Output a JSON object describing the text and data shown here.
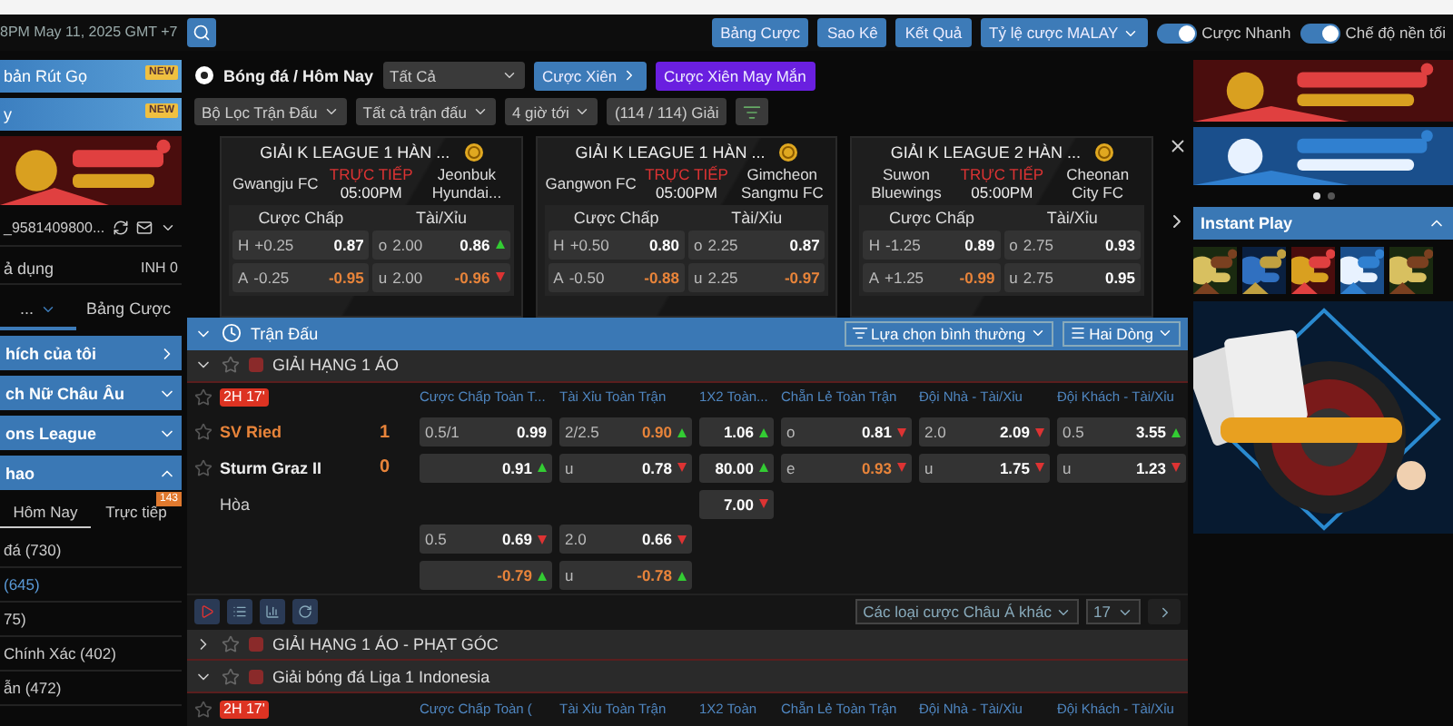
{
  "header": {
    "time": "8PM May 11, 2025 GMT +7",
    "buttons": [
      "Bảng Cược",
      "Sao Kê",
      "Kết Quả"
    ],
    "odds_type": "Tỷ lệ cược MALAY",
    "toggles": [
      {
        "label": "Cược Nhanh",
        "on": true
      },
      {
        "label": "Chế độ nền tối",
        "on": true
      }
    ]
  },
  "sidebar": {
    "promos": [
      {
        "label": "bản Rút Gọ",
        "badge": "NEW"
      },
      {
        "label": "y",
        "badge": "NEW"
      }
    ],
    "account": "_9581409800...",
    "balance_label": "ả dụng",
    "balance": "INH 0",
    "tabs": [
      {
        "label": "...",
        "selected": true
      },
      {
        "label": "Bảng Cược",
        "selected": false
      }
    ],
    "sections": [
      {
        "label": "hích của tôi",
        "kind": "link"
      },
      {
        "label": "ch Nữ Châu Âu",
        "kind": "group",
        "expanded": false
      },
      {
        "label": "ons League",
        "kind": "group",
        "expanded": false
      },
      {
        "label": "hao",
        "kind": "group",
        "expanded": true
      }
    ],
    "sport_tabs": [
      {
        "label": "Hôm Nay",
        "selected": true
      },
      {
        "label": "Trực tiếp",
        "selected": false,
        "badge": "143"
      }
    ],
    "sports": [
      {
        "label": "đá (730)",
        "selected": false
      },
      {
        "label": "(645)",
        "selected": true
      },
      {
        "label": "75)",
        "selected": false
      },
      {
        "label": "Chính Xác (402)",
        "selected": false
      },
      {
        "label": "ẫn (472)",
        "selected": false
      }
    ]
  },
  "toolbar": {
    "breadcrumb": "Bóng đá / Hôm Nay",
    "select": "Tất Cả",
    "parlay": "Cược Xiên",
    "lucky_parlay": "Cược Xiên May Mắn",
    "filters": [
      "Bộ Lọc Trận Đấu",
      "Tất cả trận đấu",
      "4 giờ tới"
    ],
    "league_count": "(114 / 114) Giải"
  },
  "featured": [
    {
      "league": "GIẢI K LEAGUE 1 HÀN ...",
      "home": "Gwangju FC",
      "away": "Jeonbuk Hyundai...",
      "status": "TRỰC TIẾP",
      "time": "05:00PM",
      "hdp_label": "Cược Chấp",
      "ou_label": "Tài/Xỉu",
      "hdp": [
        {
          "side": "H",
          "line": "+0.25",
          "odds": "0.87",
          "highlight": false
        },
        {
          "side": "A",
          "line": "-0.25",
          "odds": "-0.95",
          "highlight": true
        }
      ],
      "ou": [
        {
          "side": "o",
          "line": "2.00",
          "odds": "0.86",
          "highlight": false,
          "rising": true
        },
        {
          "side": "u",
          "line": "2.00",
          "odds": "-0.96",
          "highlight": true,
          "rising": false
        }
      ]
    },
    {
      "league": "GIẢI K LEAGUE 1 HÀN ...",
      "home": "Gangwon FC",
      "away": "Gimcheon Sangmu FC",
      "status": "TRỰC TIẾP",
      "time": "05:00PM",
      "hdp_label": "Cược Chấp",
      "ou_label": "Tài/Xỉu",
      "hdp": [
        {
          "side": "H",
          "line": "+0.50",
          "odds": "0.80",
          "highlight": false
        },
        {
          "side": "A",
          "line": "-0.50",
          "odds": "-0.88",
          "highlight": true
        }
      ],
      "ou": [
        {
          "side": "o",
          "line": "2.25",
          "odds": "0.87",
          "highlight": false
        },
        {
          "side": "u",
          "line": "2.25",
          "odds": "-0.97",
          "highlight": true
        }
      ]
    },
    {
      "league": "GIẢI K LEAGUE 2 HÀN ...",
      "home": "Suwon Bluewings",
      "away": "Cheonan City FC",
      "status": "TRỰC TIẾP",
      "time": "05:00PM",
      "hdp_label": "Cược Chấp",
      "ou_label": "Tài/Xỉu",
      "hdp": [
        {
          "side": "H",
          "line": "-1.25",
          "odds": "0.89",
          "highlight": false
        },
        {
          "side": "A",
          "line": "+1.25",
          "odds": "-0.99",
          "highlight": true
        }
      ],
      "ou": [
        {
          "side": "o",
          "line": "2.75",
          "odds": "0.93",
          "highlight": false
        },
        {
          "side": "u",
          "line": "2.75",
          "odds": "0.95",
          "highlight": false
        }
      ]
    }
  ],
  "matches_panel": {
    "title": "Trận Đấu",
    "sort": "Lựa chọn bình thường",
    "view": "Hai Dòng"
  },
  "leagues": [
    {
      "name": "GIẢI HẠNG 1 ÁO",
      "expanded": true,
      "columns": [
        "Cược Chấp Toàn T...",
        "Tài Xỉu Toàn Trận",
        "1X2 Toàn...",
        "Chẵn Lẻ Toàn Trận",
        "Đội Nhà - Tài/Xỉu",
        "Đội Khách - Tài/Xỉu"
      ],
      "match": {
        "live": "2H 17'",
        "teams": [
          {
            "name": "SV Ried",
            "score": "1",
            "highlight": true
          },
          {
            "name": "Sturm Graz II",
            "score": "0",
            "highlight": false
          }
        ],
        "draw": "Hòa",
        "rows": [
          [
            {
              "line": "0.5/1",
              "odds": "0.99",
              "highlight": false
            },
            {
              "line": "2/2.5",
              "odds": "0.90",
              "highlight": true,
              "rising": true
            },
            {
              "odds": "1.06",
              "highlight": false,
              "rising": true
            },
            {
              "line": "o",
              "odds": "0.81",
              "highlight": false,
              "rising": false
            },
            {
              "line": "2.0",
              "odds": "2.09",
              "highlight": false,
              "rising": false
            },
            {
              "line": "0.5",
              "odds": "3.55",
              "highlight": false,
              "rising": true
            }
          ],
          [
            {
              "odds": "0.91",
              "highlight": false,
              "rising": true
            },
            {
              "line": "u",
              "odds": "0.78",
              "highlight": false,
              "rising": false
            },
            {
              "odds": "80.00",
              "highlight": false,
              "rising": true
            },
            {
              "line": "e",
              "odds": "0.93",
              "highlight": true,
              "rising": false
            },
            {
              "line": "u",
              "odds": "1.75",
              "highlight": false,
              "rising": false
            },
            {
              "line": "u",
              "odds": "1.23",
              "highlight": false,
              "rising": false
            }
          ],
          [
            null,
            null,
            {
              "odds": "7.00",
              "highlight": false,
              "rising": false
            },
            null,
            null,
            null
          ],
          [
            {
              "line": "0.5",
              "odds": "0.69",
              "highlight": false,
              "rising": false
            },
            {
              "line": "2.0",
              "odds": "0.66",
              "highlight": false,
              "rising": false
            },
            null,
            null,
            null,
            null
          ],
          [
            {
              "odds": "-0.79",
              "highlight": true,
              "rising": true
            },
            {
              "line": "u",
              "odds": "-0.78",
              "highlight": true,
              "rising": true
            },
            null,
            null,
            null,
            null
          ]
        ],
        "more_bets": "Các loại cược Châu Á khác",
        "count": "17"
      }
    },
    {
      "name": "GIẢI HẠNG 1 ÁO - PHẠT GÓC",
      "expanded": false
    },
    {
      "name": "Giải bóng đá Liga 1 Indonesia",
      "expanded": true,
      "live": "2H 17'",
      "columns": [
        "Cược Chấp Toàn (",
        "Tài Xỉu Toàn Trận",
        "1X2 Toàn",
        "Chẵn Lẻ Toàn Trận",
        "Đội Nhà - Tài/Xỉu",
        "Đội Khách - Tài/Xỉu"
      ]
    }
  ],
  "right": {
    "carousel": [
      {
        "selected": true
      },
      {
        "selected": false
      }
    ],
    "instant_play": {
      "title": "Instant Play",
      "expanded": true
    }
  }
}
